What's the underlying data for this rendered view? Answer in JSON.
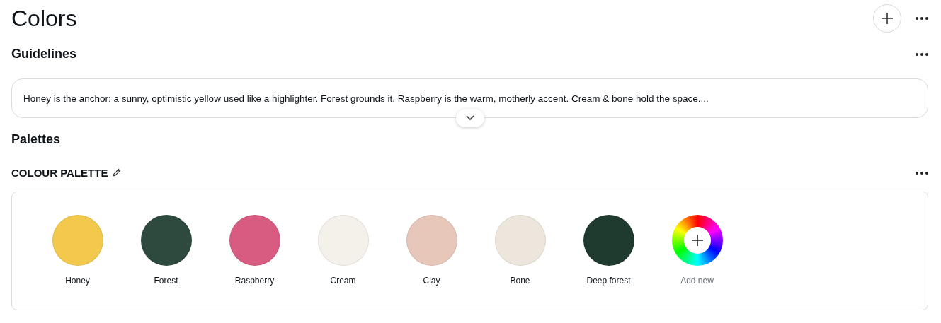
{
  "page": {
    "title": "Colors"
  },
  "guidelines": {
    "heading": "Guidelines",
    "text": "Honey is the anchor: a sunny, optimistic yellow used like a highlighter. Forest grounds it. Raspberry is the warm, motherly accent. Cream & bone hold the space...."
  },
  "palettes": {
    "heading": "Palettes",
    "palette_name": "COLOUR PALETTE",
    "colors": [
      {
        "name": "Honey",
        "color": "#f2c94c"
      },
      {
        "name": "Forest",
        "color": "#2e4a3e"
      },
      {
        "name": "Raspberry",
        "color": "#d85b82"
      },
      {
        "name": "Cream",
        "color": "#f4f0ea"
      },
      {
        "name": "Clay",
        "color": "#e6c7ba"
      },
      {
        "name": "Bone",
        "color": "#ede6dc"
      },
      {
        "name": "Deep forest",
        "color": "#1f3a2f"
      }
    ],
    "add_label": "Add new"
  }
}
